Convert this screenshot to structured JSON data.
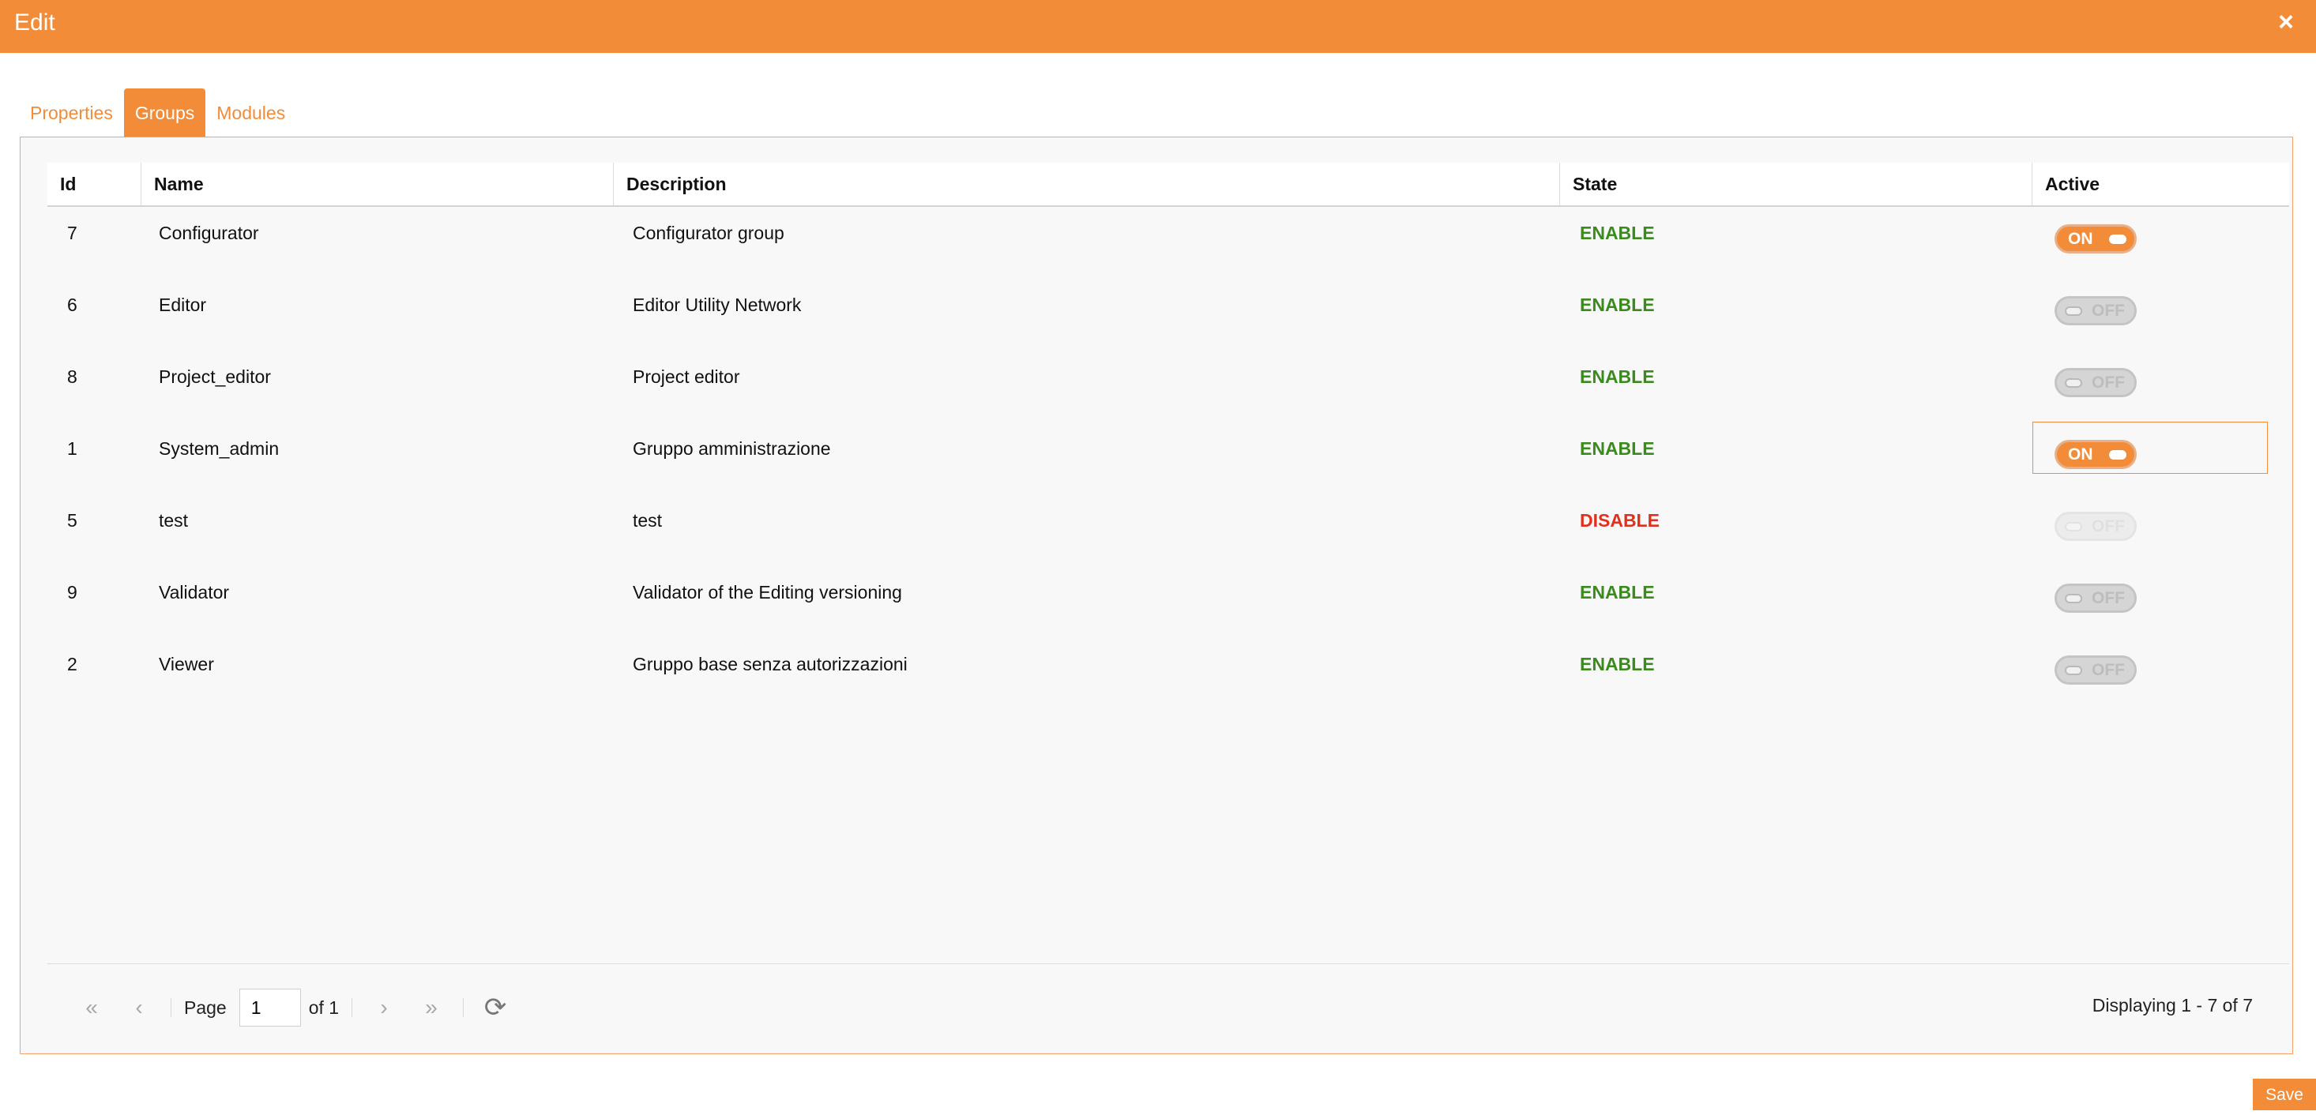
{
  "window": {
    "title": "Edit",
    "close_glyph": "×"
  },
  "tabs": [
    {
      "label": "Properties",
      "active": false
    },
    {
      "label": "Groups",
      "active": true
    },
    {
      "label": "Modules",
      "active": false
    }
  ],
  "grid": {
    "columns": [
      "Id",
      "Name",
      "Description",
      "State",
      "Active"
    ],
    "rows": [
      {
        "id": "7",
        "name": "Configurator",
        "description": "Configurator group",
        "state": "ENABLE",
        "active": "ON"
      },
      {
        "id": "6",
        "name": "Editor",
        "description": "Editor Utility Network",
        "state": "ENABLE",
        "active": "OFF"
      },
      {
        "id": "8",
        "name": "Project_editor",
        "description": "Project editor",
        "state": "ENABLE",
        "active": "OFF"
      },
      {
        "id": "1",
        "name": "System_admin",
        "description": "Gruppo amministrazione",
        "state": "ENABLE",
        "active": "ON"
      },
      {
        "id": "5",
        "name": "test",
        "description": "test",
        "state": "DISABLE",
        "active": "OFF"
      },
      {
        "id": "9",
        "name": "Validator",
        "description": "Validator of the Editing versioning",
        "state": "ENABLE",
        "active": "OFF"
      },
      {
        "id": "2",
        "name": "Viewer",
        "description": "Gruppo base senza autorizzazioni",
        "state": "ENABLE",
        "active": "OFF"
      }
    ],
    "focused_row_index": 3
  },
  "pager": {
    "page_label": "Page",
    "page_value": "1",
    "of_label": "of 1",
    "displaying": "Displaying 1 - 7 of 7"
  },
  "footer": {
    "save_label": "Save"
  },
  "colors": {
    "accent": "#f28c38",
    "enable": "#3b8a1e",
    "disable": "#e0301e"
  },
  "icons": {
    "first": "first-page-icon",
    "prev": "prev-page-icon",
    "next": "next-page-icon",
    "last": "last-page-icon",
    "refresh": "refresh-icon",
    "close": "close-icon"
  }
}
